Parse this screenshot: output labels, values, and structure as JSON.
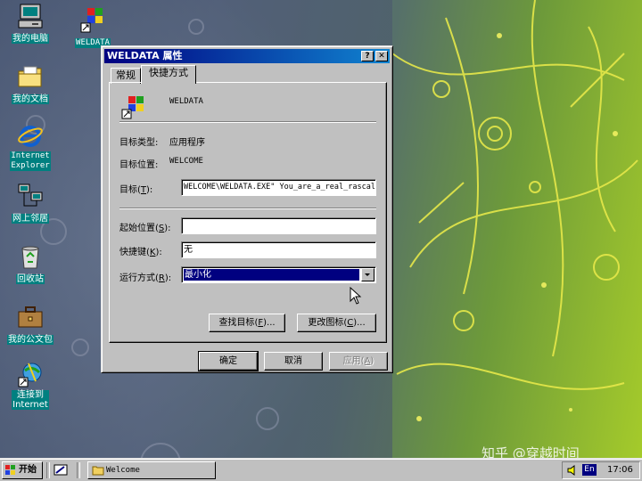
{
  "desktop": {
    "icons": [
      {
        "label": "我的电脑",
        "icon": "my-computer-icon"
      },
      {
        "label": "WELDATA",
        "icon": "weldata-shortcut-icon"
      },
      {
        "label": "我的文档",
        "icon": "my-documents-icon"
      },
      {
        "label": "Internet\nExplorer",
        "icon": "internet-explorer-icon"
      },
      {
        "label": "网上邻居",
        "icon": "network-neighborhood-icon"
      },
      {
        "label": "回收站",
        "icon": "recycle-bin-icon"
      },
      {
        "label": "我的公文包",
        "icon": "briefcase-icon"
      },
      {
        "label": "连接到\nInternet",
        "icon": "connect-internet-icon"
      }
    ],
    "watermark": "知乎 @穿越时间"
  },
  "dialog": {
    "title": "WELDATA 属性",
    "help_button": "?",
    "close_button": "✕",
    "tabs": [
      {
        "label": "常规",
        "active": false
      },
      {
        "label": "快捷方式",
        "active": true
      }
    ],
    "shortcut_name": "WELDATA",
    "target_type_label": "目标类型:",
    "target_type_value": "应用程序",
    "target_location_label": "目标位置:",
    "target_location_value": "WELCOME",
    "target_label": "目标",
    "target_key": "T",
    "target_value": "WELCOME\\WELDATA.EXE\" You_are_a_real_rascal",
    "start_in_label": "起始位置",
    "start_in_key": "S",
    "start_in_value": "",
    "hotkey_label": "快捷键",
    "hotkey_key": "K",
    "hotkey_value": "无",
    "run_label": "运行方式",
    "run_key": "R",
    "run_value": "最小化",
    "find_target_label": "查找目标",
    "find_target_key": "F",
    "change_icon_label": "更改图标",
    "change_icon_key": "C",
    "ok_label": "确定",
    "cancel_label": "取消",
    "apply_label": "应用",
    "apply_key": "A"
  },
  "taskbar": {
    "start_label": "开始",
    "task_label": "Welcome",
    "language": "En",
    "clock": "17:06"
  },
  "colors": {
    "title_bar": "#000080",
    "selection": "#000080",
    "face": "#c0c0c0",
    "desktop_label_bg": "#008080"
  }
}
